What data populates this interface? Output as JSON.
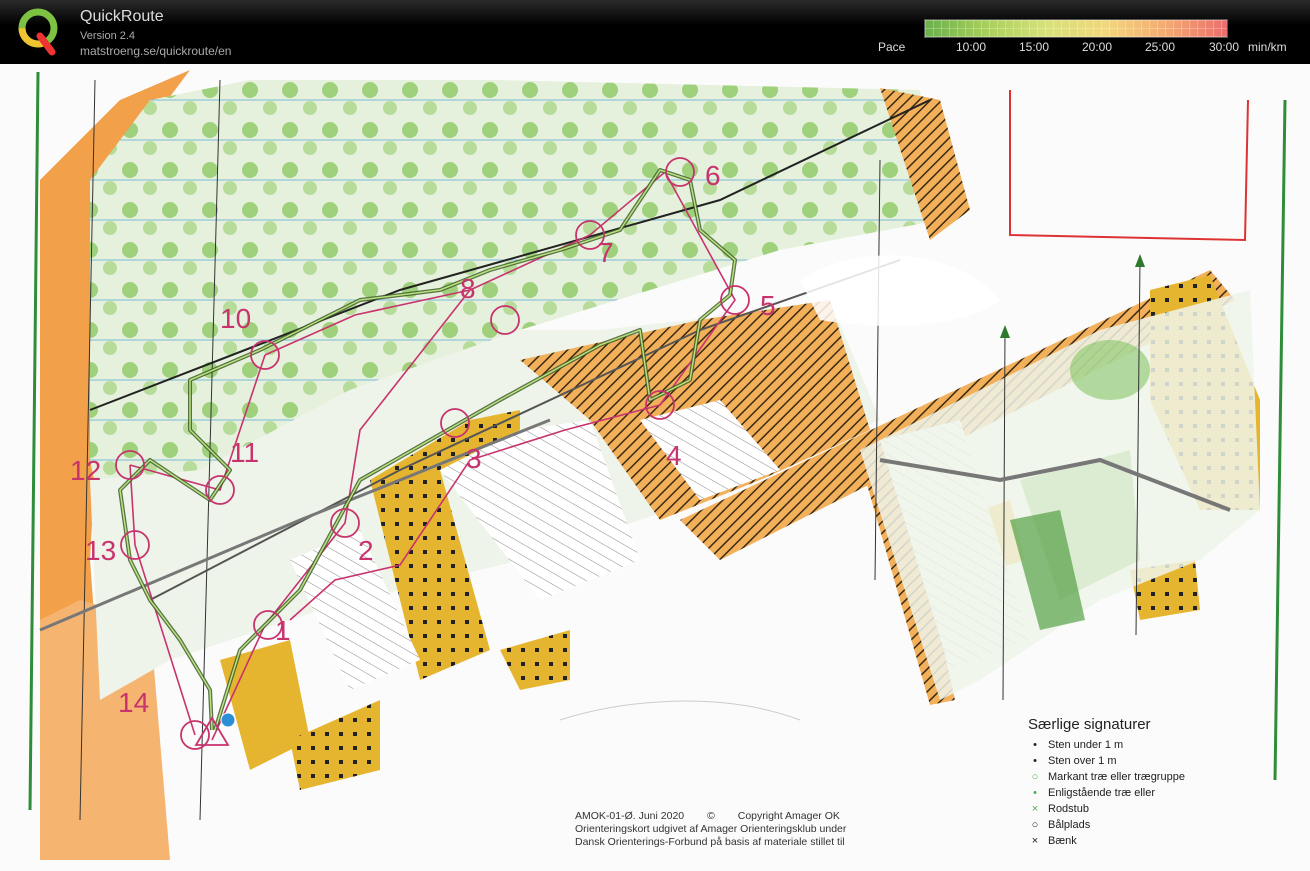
{
  "header": {
    "app_title": "QuickRoute",
    "version": "Version 2.4",
    "url": "matstroeng.se/quickroute/en",
    "pace_label": "Pace",
    "pace_ticks": [
      "10:00",
      "15:00",
      "20:00",
      "25:00",
      "30:00"
    ],
    "pace_unit": "min/km"
  },
  "map": {
    "controls": [
      "1",
      "2",
      "3",
      "4",
      "5",
      "6",
      "7",
      "8",
      "10",
      "11",
      "12",
      "13",
      "14"
    ],
    "legend": {
      "title": "Særlige signaturer",
      "items": [
        {
          "symbol": "•",
          "label": "Sten under 1 m"
        },
        {
          "symbol": "•",
          "label": "Sten over 1 m"
        },
        {
          "symbol": "○",
          "label": "Markant træ eller trægruppe"
        },
        {
          "symbol": "•",
          "label": "Enligstående træ eller"
        },
        {
          "symbol": "×",
          "label": "Rodstub"
        },
        {
          "symbol": "○",
          "label": "Bålplads"
        },
        {
          "symbol": "×",
          "label": "Bænk"
        }
      ]
    },
    "credits": {
      "map_id": "AMOK-01-Ø. Juni 2020",
      "copyright": "Copyright Amager OK",
      "line2": "Orienteringskort udgivet af Amager Orienteringsklub under",
      "line3": "Dansk Orienterings-Forbund på basis af materiale stillet til"
    }
  },
  "colors": {
    "course": "#c8336e",
    "route": "#3f5a2a",
    "open_land": "#e8b53a",
    "forest_green": "#7cc15b",
    "orange": "#f2a04a"
  }
}
